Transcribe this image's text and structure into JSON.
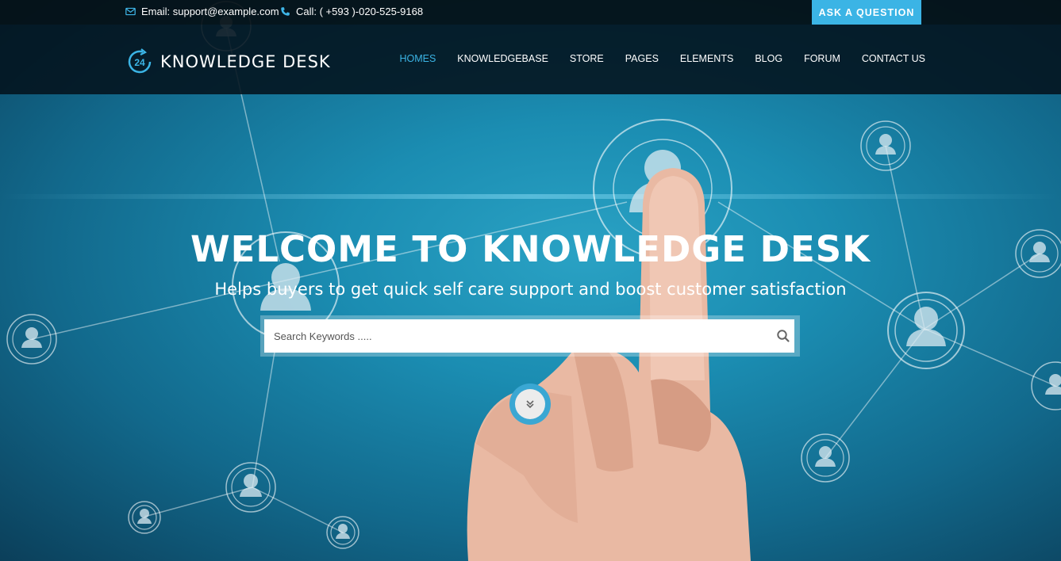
{
  "topbar": {
    "email": "Email: support@example.com",
    "call": "Call: ( +593 )-020-525-9168",
    "ask_button": "ASK A QUESTION"
  },
  "logo": {
    "badge": "24",
    "text": "KNOWLEDGE DESK"
  },
  "nav": [
    "HOMES",
    "KNOWLEDGEBASE",
    "STORE",
    "PAGES",
    "ELEMENTS",
    "BLOG",
    "FORUM",
    "CONTACT US"
  ],
  "hero": {
    "title": "WELCOME TO KNOWLEDGE DESK",
    "subtitle": "Helps buyers to get quick self care support and boost customer satisfaction"
  },
  "search": {
    "placeholder": "Search Keywords ....."
  },
  "colors": {
    "accent": "#3bb4e5",
    "hero": "#1b8db2",
    "header": "#03121c"
  },
  "icons": [
    "mail-icon",
    "phone-icon",
    "search-icon",
    "chevrons-down-icon",
    "user-icon"
  ]
}
